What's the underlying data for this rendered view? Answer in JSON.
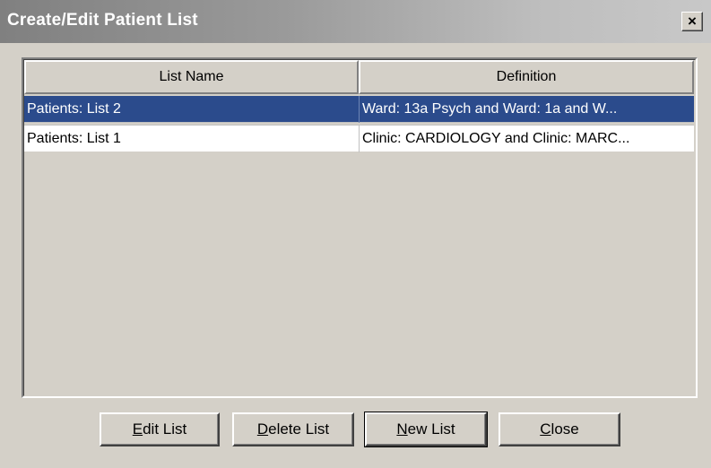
{
  "window": {
    "title": "Create/Edit Patient List",
    "close_glyph": "×"
  },
  "list": {
    "columns": [
      "List Name",
      "Definition"
    ],
    "rows": [
      {
        "name": "Patients: List 2",
        "definition": "Ward: 13a Psych and Ward: 1a and W...",
        "selected": true
      },
      {
        "name": "Patients: List 1",
        "definition": "Clinic: CARDIOLOGY and Clinic: MARC...",
        "selected": false
      }
    ]
  },
  "buttons": {
    "edit": {
      "mnemonic": "E",
      "rest": "dit List"
    },
    "delete": {
      "mnemonic": "D",
      "rest": "elete List"
    },
    "new": {
      "mnemonic": "N",
      "rest": "ew List"
    },
    "close": {
      "mnemonic": "C",
      "rest": "lose"
    }
  },
  "colors": {
    "selection": "#2b4b8c",
    "face": "#d4d0c8"
  }
}
